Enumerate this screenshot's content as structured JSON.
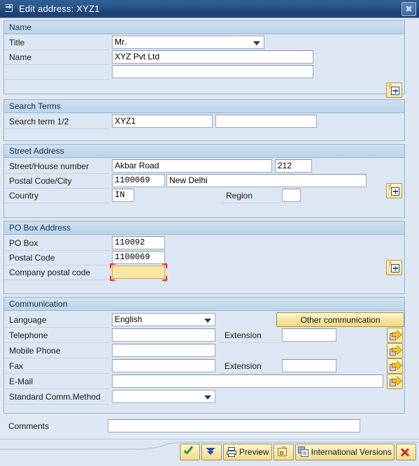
{
  "window": {
    "title": "Edit address:  XYZ1",
    "icon": "edit-window-icon",
    "close_label": "✖"
  },
  "sections": {
    "name": {
      "header": "Name",
      "title_label": "Title",
      "title_value": "Mr.",
      "name_label": "Name",
      "name_value": "XYZ Pvt Ltd",
      "name2_value": ""
    },
    "search_terms": {
      "header": "Search Terms",
      "search_label": "Search term 1/2",
      "search1_value": "XYZ1",
      "search2_value": ""
    },
    "street_address": {
      "header": "Street Address",
      "street_label": "Street/House number",
      "street_value": "Akbar Road",
      "house_value": "212",
      "postal_city_label": "Postal Code/City",
      "postal_value": "1100069",
      "city_value": "New Delhi",
      "country_label": "Country",
      "country_value": "IN",
      "region_label": "Region",
      "region_value": ""
    },
    "po_box": {
      "header": "PO Box Address",
      "pobox_label": "PO Box",
      "pobox_value": "110092",
      "postal_label": "Postal Code",
      "postal_value": "1100069",
      "company_postal_label": "Company postal code",
      "company_postal_value": ""
    },
    "communication": {
      "header": "Communication",
      "language_label": "Language",
      "language_value": "English",
      "other_comm_button": "Other communication",
      "telephone_label": "Telephone",
      "telephone_value": "",
      "telephone_ext_label": "Extension",
      "telephone_ext_value": "",
      "mobile_label": "Mobile Phone",
      "mobile_value": "",
      "fax_label": "Fax",
      "fax_value": "",
      "fax_ext_label": "Extension",
      "fax_ext_value": "",
      "email_label": "E-Mail",
      "email_value": "",
      "std_comm_label": "Standard Comm.Method",
      "std_comm_value": ""
    },
    "comments": {
      "label": "Comments",
      "value": ""
    }
  },
  "toolbar": {
    "continue_label": "",
    "more_label": "",
    "preview_label": "Preview",
    "lock_label": "",
    "international_label": "International Versions",
    "cancel_label": ""
  },
  "colors": {
    "titlebar": "#24497c",
    "panel_bg": "#dce7f3",
    "panel_border": "#9bb4cd",
    "header_grad_top": "#cfe0f0",
    "focus_field": "#fbe6a2",
    "focus_bracket": "#e03030",
    "button_yellow": "#f7e49c"
  }
}
